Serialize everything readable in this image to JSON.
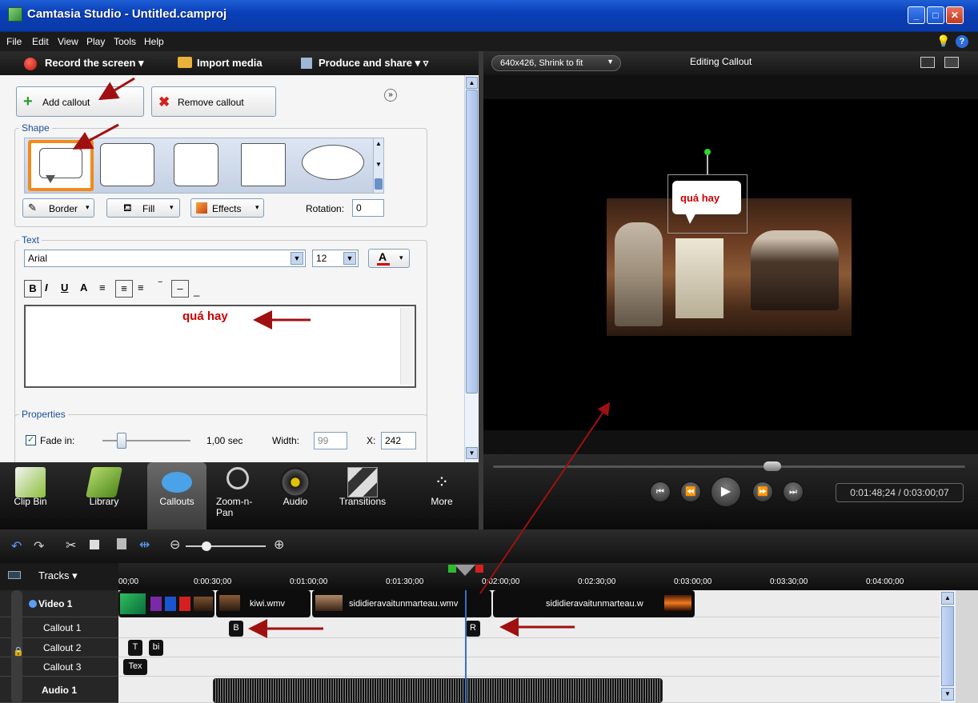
{
  "window": {
    "title": "Camtasia Studio - Untitled.camproj"
  },
  "menu": [
    "File",
    "Edit",
    "View",
    "Play",
    "Tools",
    "Help"
  ],
  "toolbar": {
    "record": "Record the screen",
    "import": "Import media",
    "produce": "Produce and share"
  },
  "callout": {
    "add_label": "Add callout",
    "remove_label": "Remove callout",
    "shape_group": "Shape",
    "border_label": "Border",
    "fill_label": "Fill",
    "effects_label": "Effects",
    "rotation_label": "Rotation:",
    "rotation_value": "0",
    "text_group": "Text",
    "font": "Arial",
    "font_size": "12",
    "text_value": "quá hay",
    "properties_group": "Properties",
    "fade_in_label": "Fade in:",
    "fade_in_value": "1,00 sec",
    "width_label": "Width:",
    "width_value": "99",
    "x_label": "X:",
    "x_value": "242"
  },
  "tabs": [
    {
      "label": "Clip Bin",
      "icon": "clip-bin-icon"
    },
    {
      "label": "Library",
      "icon": "library-icon"
    },
    {
      "label": "Callouts",
      "icon": "callouts-icon"
    },
    {
      "label": "Zoom-n-\nPan",
      "icon": "zoom-pan-icon"
    },
    {
      "label": "Audio",
      "icon": "audio-icon"
    },
    {
      "label": "Transitions",
      "icon": "transitions-icon"
    },
    {
      "label": "More",
      "icon": "more-icon"
    }
  ],
  "preview": {
    "size_dropdown": "640x426, Shrink to fit",
    "title": "Editing Callout",
    "callout_text": "quá hay",
    "time": "0:01:48;24 / 0:03:00;07"
  },
  "timeline": {
    "tracks_label": "Tracks",
    "ruler": [
      "00;00",
      "0:00:30;00",
      "0:01:00;00",
      "0:01:30;00",
      "0:02:00;00",
      "0:02:30;00",
      "0:03:00;00",
      "0:03:30;00",
      "0:04:00;00"
    ],
    "track_names": [
      "Video 1",
      "Callout 1",
      "Callout 2",
      "Callout 3",
      "Audio 1"
    ],
    "clips": [
      "kiwi.wmv",
      "sididieravaitunmarteau.wmv",
      "sididieravaitunmarteau.w"
    ],
    "callout1_markers": [
      "B",
      "R"
    ],
    "callout2_markers": [
      "T",
      "bi"
    ],
    "callout3_markers": [
      "Tex"
    ]
  },
  "colors": {
    "accent_orange": "#f08a1c",
    "arrow_red": "#a01010",
    "callout_text": "#cc0000"
  }
}
